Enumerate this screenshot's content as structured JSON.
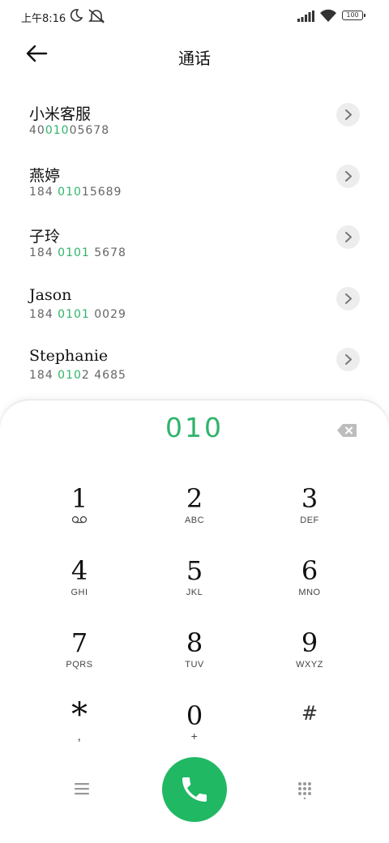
{
  "status_bar": {
    "time": "上午8:16",
    "battery": "100"
  },
  "header": {
    "title": "通话"
  },
  "contacts": [
    {
      "name": "小米客服",
      "number_pre": "40",
      "number_match": "010",
      "number_post": "05678"
    },
    {
      "name": "燕婷",
      "number_pre": "184 ",
      "number_match": "010",
      "number_post": "15689"
    },
    {
      "name": "子玲",
      "number_pre": "184 ",
      "number_match": "0101",
      "number_post": " 5678"
    },
    {
      "name": "Jason",
      "number_pre": "184 ",
      "number_match": "0101",
      "number_post": " 0029"
    },
    {
      "name": "Stephanie",
      "number_pre": "184 ",
      "number_match": "010",
      "number_post": "2 4685"
    }
  ],
  "dialpad": {
    "display": "010",
    "keys": [
      {
        "digit": "1",
        "letters": ""
      },
      {
        "digit": "2",
        "letters": "ABC"
      },
      {
        "digit": "3",
        "letters": "DEF"
      },
      {
        "digit": "4",
        "letters": "GHI"
      },
      {
        "digit": "5",
        "letters": "JKL"
      },
      {
        "digit": "6",
        "letters": "MNO"
      },
      {
        "digit": "7",
        "letters": "PQRS"
      },
      {
        "digit": "8",
        "letters": "TUV"
      },
      {
        "digit": "9",
        "letters": "WXYZ"
      },
      {
        "digit": "*",
        "letters": ","
      },
      {
        "digit": "0",
        "letters": "+"
      },
      {
        "digit": "#",
        "letters": ""
      }
    ]
  },
  "icons": {
    "back": "back-arrow-icon",
    "chevron": "chevron-right-icon",
    "delete": "backspace-icon",
    "voicemail": "voicemail-icon",
    "menu": "menu-icon",
    "call": "phone-icon",
    "hide_keypad": "keypad-grid-icon"
  },
  "colors": {
    "accent": "#2fb46b",
    "call_button": "#21b864"
  }
}
